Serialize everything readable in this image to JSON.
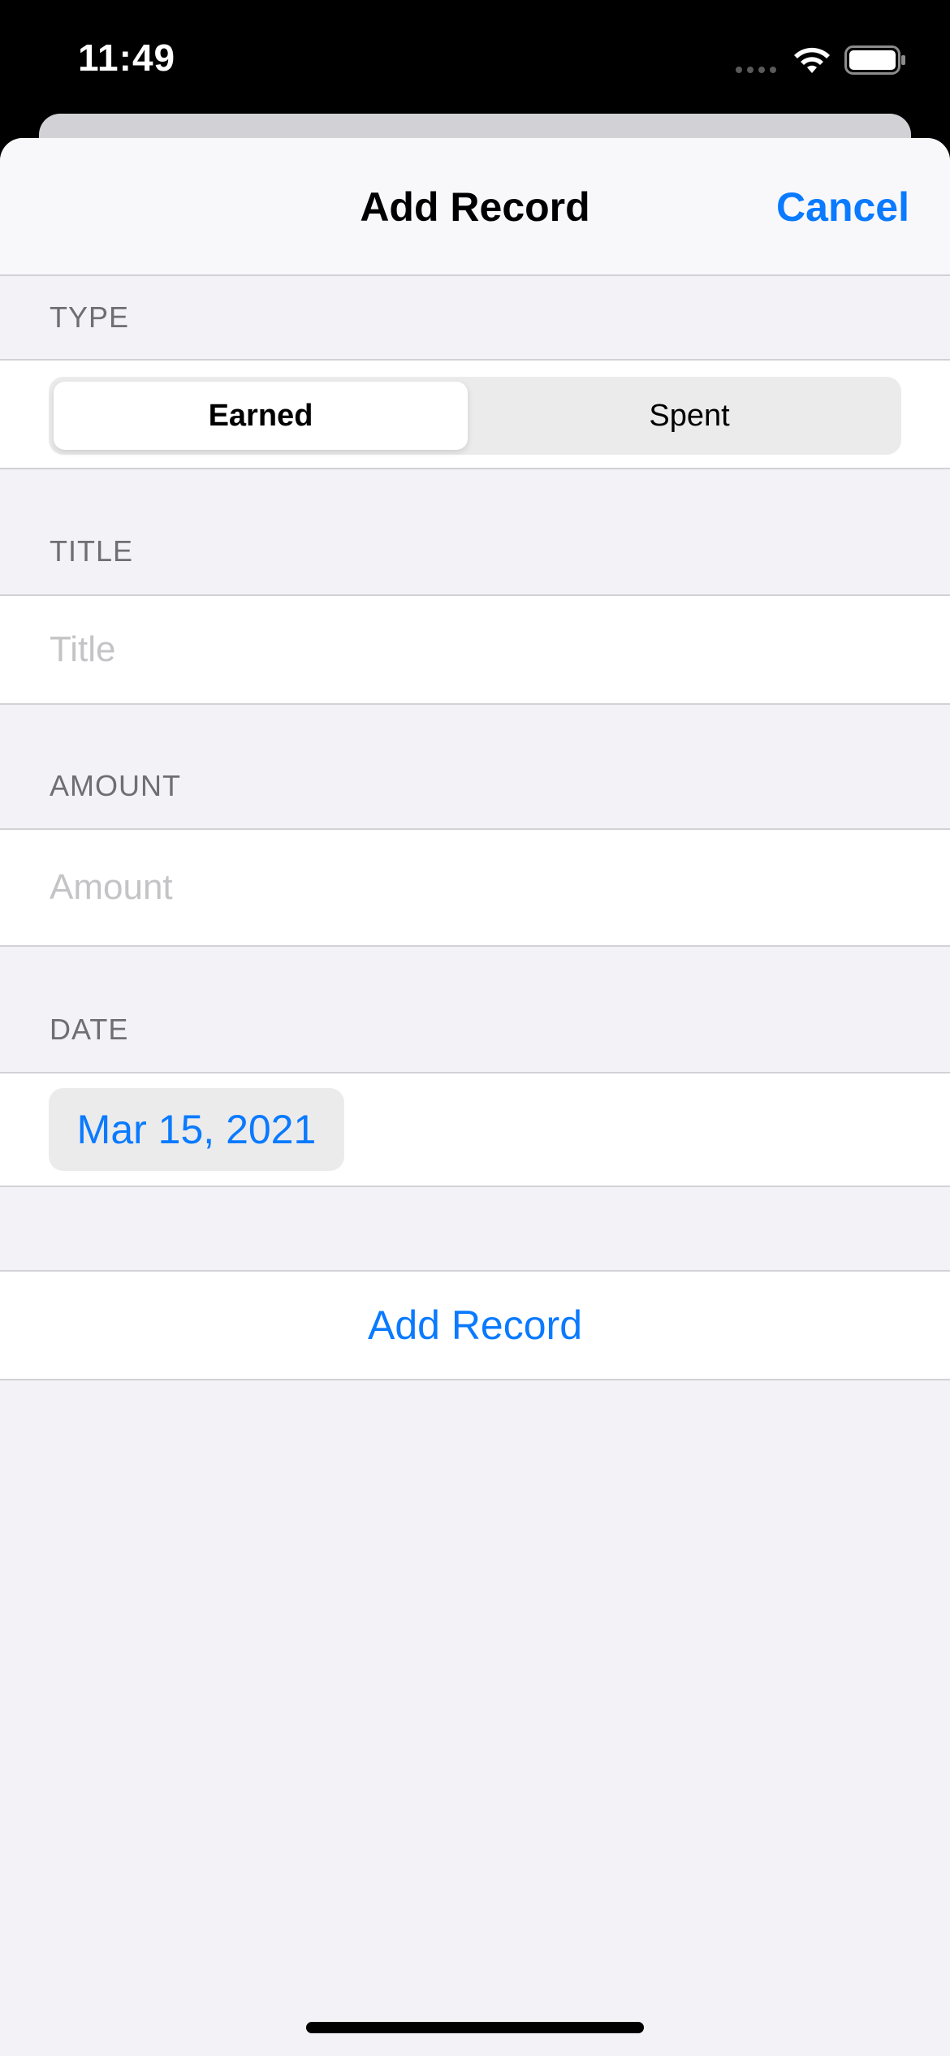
{
  "status_bar": {
    "time": "11:49",
    "signal_icon": "cellular-signal-icon",
    "wifi_icon": "wifi-icon",
    "battery_icon": "battery-icon"
  },
  "nav": {
    "title": "Add Record",
    "cancel_label": "Cancel"
  },
  "type_section": {
    "header": "TYPE",
    "segments": [
      {
        "label": "Earned",
        "selected": true
      },
      {
        "label": "Spent",
        "selected": false
      }
    ]
  },
  "title_section": {
    "header": "TITLE",
    "placeholder": "Title",
    "value": ""
  },
  "amount_section": {
    "header": "AMOUNT",
    "placeholder": "Amount",
    "value": ""
  },
  "date_section": {
    "header": "DATE",
    "value": "Mar 15, 2021"
  },
  "actions": {
    "add_record_label": "Add Record"
  },
  "colors": {
    "accent": "#0a7aff",
    "grouped_background": "#f2f2f7",
    "cell_background": "#ffffff"
  }
}
